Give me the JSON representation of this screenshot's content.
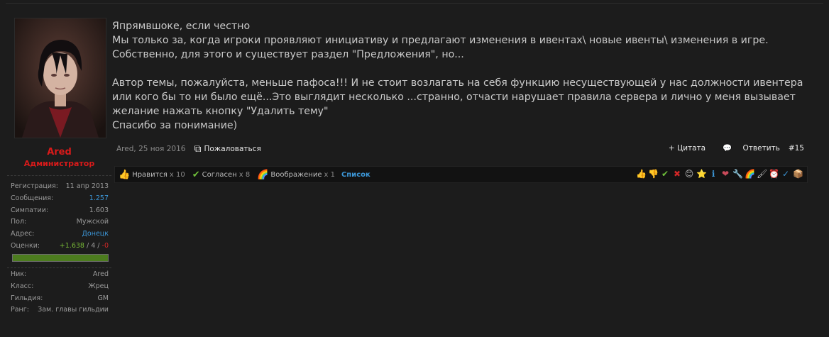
{
  "user": {
    "name": "Ared",
    "title": "Администратор",
    "stats": [
      {
        "label": "Регистрация:",
        "value": "11 апр 2013",
        "link": false
      },
      {
        "label": "Сообщения:",
        "value": "1.257",
        "link": true
      },
      {
        "label": "Симпатии:",
        "value": "1.603",
        "link": false
      },
      {
        "label": "Пол:",
        "value": "Мужской",
        "link": false
      },
      {
        "label": "Адрес:",
        "value": "Донецк",
        "link": true
      }
    ],
    "ratings": {
      "label": "Оценки:",
      "positive": "+1.638",
      "sep1": " / ",
      "neutral": "4",
      "sep2": " / ",
      "negative": "-0",
      "fraction": 0.998
    },
    "game": [
      {
        "label": "Ник:",
        "value": "Ared"
      },
      {
        "label": "Класс:",
        "value": "Жрец"
      },
      {
        "label": "Гильдия:",
        "value": "GM"
      },
      {
        "label": "Ранг:",
        "value": "Зам. главы гильдии"
      }
    ]
  },
  "message": {
    "lines": [
      "Япрямвшоке, если честно",
      "Мы только за, когда игроки проявляют инициативу и предлагают изменения в ивентах\\ новые ивенты\\ изменения в игре. Собственно, для этого и существует раздел \"Предложения\", но...",
      "",
      "Автор темы, пожалуйста, меньше пафоса!!! И не стоит возлагать на себя функцию несуществующей у нас должности ивентера или кого бы то ни было ещё...Это выглядит несколько ...странно, отчасти нарушает правила сервера и лично у меня вызывает желание нажать кнопку \"Удалить тему\"",
      "Спасибо за понимание)"
    ]
  },
  "meta": {
    "author_date": "Ared, 25 ноя 2016",
    "report": "Пожаловаться"
  },
  "actions": {
    "quote": "+ Цитата",
    "reply": "Ответить",
    "post_number": "#15"
  },
  "likes": {
    "items": [
      {
        "icon": "thumbs-up-icon",
        "label": "Нравится",
        "count": "x 10"
      },
      {
        "icon": "checkmark-icon",
        "label": "Согласен",
        "count": "x 8"
      },
      {
        "icon": "rainbow-icon",
        "label": "Воображение",
        "count": "x 1"
      }
    ],
    "list_link": "Список"
  },
  "colors": {
    "accent_red": "#d91a1a",
    "link_blue": "#3c97d8",
    "positive": "#77b836",
    "negative": "#d22727",
    "background": "#1c1c1c"
  }
}
